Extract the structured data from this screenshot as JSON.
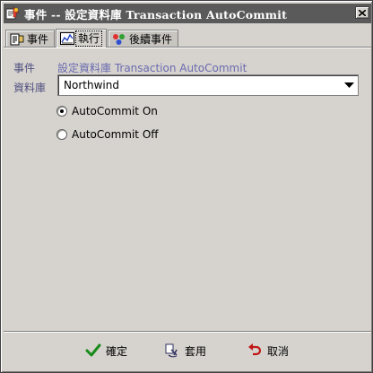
{
  "window": {
    "title": "事件 -- 設定資料庫 Transaction AutoCommit"
  },
  "tabs": [
    {
      "label": "事件",
      "icon": "event-icon",
      "active": false
    },
    {
      "label": "執行",
      "icon": "chart-icon",
      "active": true
    },
    {
      "label": "後續事件",
      "icon": "followup-icon",
      "active": false
    }
  ],
  "form": {
    "event_label": "事件",
    "event_value": "設定資料庫 Transaction AutoCommit",
    "database_label": "資料庫",
    "database_value": "Northwind",
    "options": [
      {
        "label": "AutoCommit On",
        "checked": true
      },
      {
        "label": "AutoCommit Off",
        "checked": false
      }
    ]
  },
  "buttons": {
    "ok": "確定",
    "apply": "套用",
    "cancel": "取消"
  },
  "colors": {
    "title_bar": "#5a5a5a",
    "dialog_bg": "#d6d3ce",
    "label_text": "#505080",
    "value_text": "#6b6bb0"
  }
}
